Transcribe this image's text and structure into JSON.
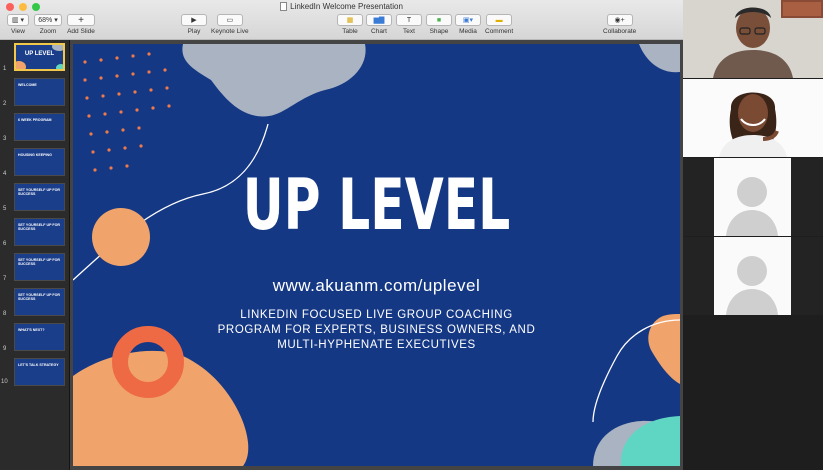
{
  "window": {
    "title": "LinkedIn Welcome Presentation"
  },
  "toolbar": {
    "view_label": "View",
    "zoom_value": "68%",
    "zoom_label": "Zoom",
    "add_slide_label": "Add Slide",
    "play_label": "Play",
    "keynote_live_label": "Keynote Live",
    "table_label": "Table",
    "chart_label": "Chart",
    "text_label": "Text",
    "shape_label": "Shape",
    "media_label": "Media",
    "comment_label": "Comment",
    "collaborate_label": "Collaborate"
  },
  "slides": [
    {
      "number": "1",
      "title": "UP LEVEL",
      "subtitle": ""
    },
    {
      "number": "2",
      "title": "WELCOME",
      "subtitle": ""
    },
    {
      "number": "3",
      "title": "6 WEEK PROGRAM",
      "subtitle": ""
    },
    {
      "number": "4",
      "title": "HOUSING KEEPING",
      "subtitle": ""
    },
    {
      "number": "5",
      "title": "SET YOURSELF UP FOR\nSUCCESS",
      "subtitle": ""
    },
    {
      "number": "6",
      "title": "SET YOURSELF UP FOR\nSUCCESS",
      "subtitle": ""
    },
    {
      "number": "7",
      "title": "SET YOURSELF UP FOR\nSUCCESS",
      "subtitle": ""
    },
    {
      "number": "8",
      "title": "SET YOURSELF UP FOR\nSUCCESS",
      "subtitle": ""
    },
    {
      "number": "9",
      "title": "WHAT'S NEXT?",
      "subtitle": ""
    },
    {
      "number": "10",
      "title": "LET'S TALK STRATEGY",
      "subtitle": ""
    }
  ],
  "main_slide": {
    "title": "UP LEVEL",
    "url": "www.akuanm.com/uplevel",
    "tagline_lines": [
      "LINKEDIN FOCUSED LIVE GROUP COACHING",
      "PROGRAM FOR EXPERTS, BUSINESS OWNERS, AND",
      "MULTI-HYPHENATE EXECUTIVES"
    ]
  },
  "colors": {
    "slide_bg": "#153885",
    "orange": "#f0a46b",
    "coral": "#ee6a45",
    "gray_blob": "#a9b3c2",
    "teal": "#5fd6c3",
    "selection": "#f2c84b"
  }
}
